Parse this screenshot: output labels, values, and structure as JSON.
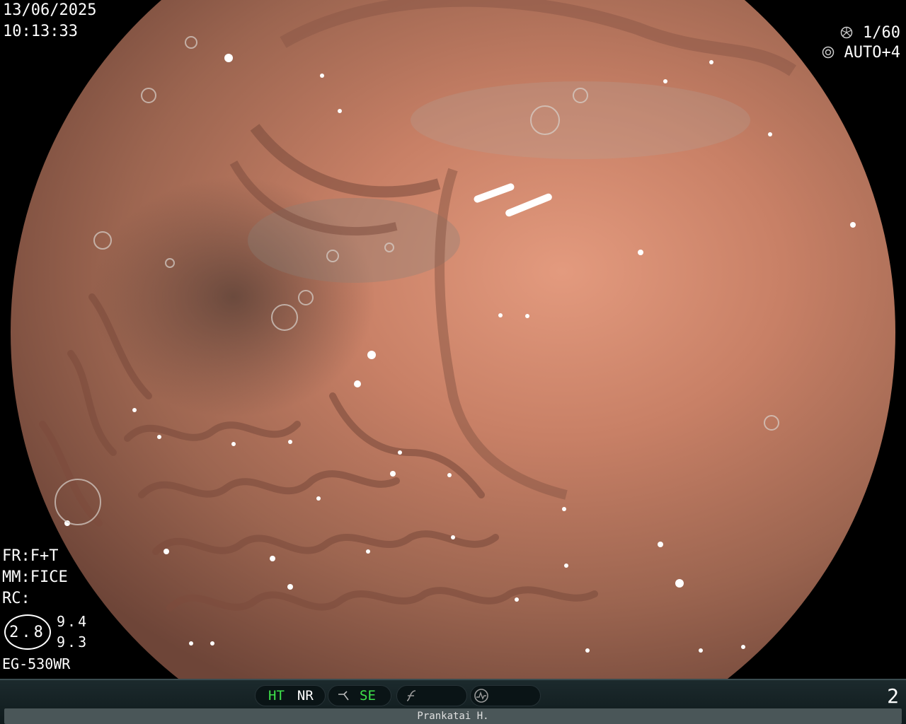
{
  "header": {
    "date": "13/06/2025",
    "time": "10:13:33",
    "shutter": "1/60",
    "exposure": "AUTO+4",
    "shutter_icon": "aperture-icon",
    "exposure_icon": "iris-icon"
  },
  "settings": {
    "fr": "FR:F+T",
    "mm": "MM:FICE",
    "rc": "RC:",
    "zoom": "2.8",
    "value_a": "9.4",
    "value_b": "9.3",
    "scope": "EG-530WR"
  },
  "bottom_bar": {
    "ht": "HT",
    "nr": "NR",
    "se": "SE",
    "se_icon": "enhance-icon",
    "f_icon": "f-curve-icon",
    "wave_icon": "waveform-circle-icon",
    "page": "2",
    "patient": "Prankatai H."
  },
  "colors": {
    "tissue": "#b07258",
    "tissue_light": "#d98f74",
    "highlight": "#3ee24a"
  }
}
